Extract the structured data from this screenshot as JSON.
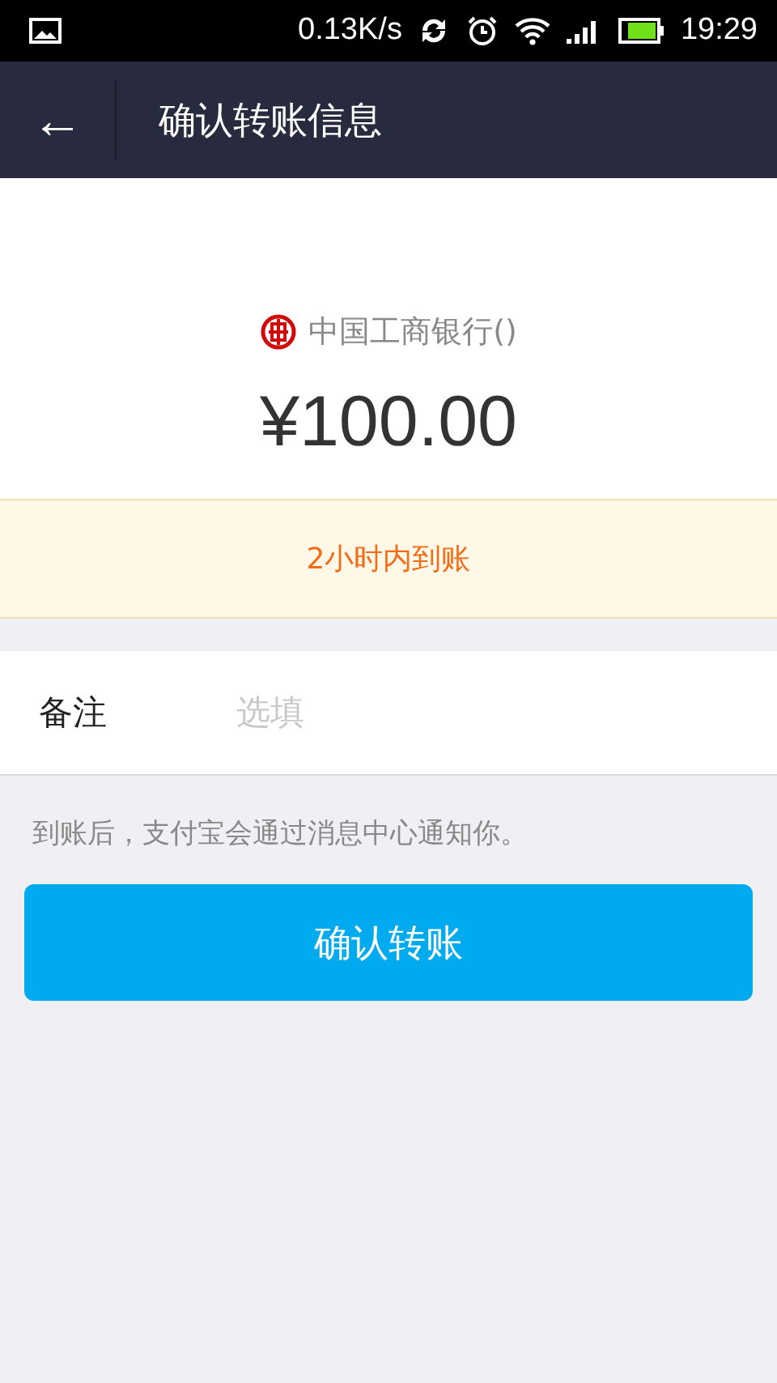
{
  "status_bar": {
    "speed": "0.13K/s",
    "time": "19:29"
  },
  "header": {
    "back": "←",
    "title": "确认转账信息"
  },
  "recipient": {
    "bank": "中国工商银行()",
    "amount": "¥100.00"
  },
  "notice": "2小时内到账",
  "remark": {
    "label": "备注",
    "placeholder": "选填"
  },
  "hint": "到账后，支付宝会通过消息中心通知你。",
  "confirm_button": "确认转账"
}
